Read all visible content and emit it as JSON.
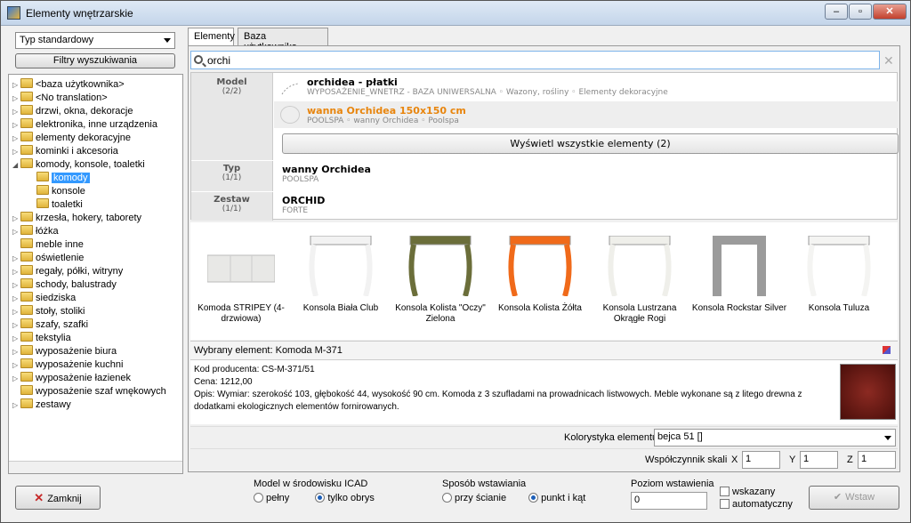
{
  "window": {
    "title": "Elementy wnętrzarskie",
    "min": "–",
    "max": "▫",
    "close": "✕"
  },
  "left": {
    "combo_value": "Typ standardowy",
    "filter_button": "Filtry wyszukiwania",
    "tree": [
      {
        "label": "<baza użytkownika>",
        "level": 0,
        "expander": "▷"
      },
      {
        "label": "<No translation>",
        "level": 0,
        "expander": "▷"
      },
      {
        "label": "drzwi, okna, dekoracje",
        "level": 0,
        "expander": "▷"
      },
      {
        "label": "elektronika, inne urządzenia",
        "level": 0,
        "expander": "▷"
      },
      {
        "label": "elementy dekoracyjne",
        "level": 0,
        "expander": "▷"
      },
      {
        "label": "kominki i akcesoria",
        "level": 0,
        "expander": "▷"
      },
      {
        "label": "komody, konsole, toaletki",
        "level": 0,
        "expander": "◢"
      },
      {
        "label": "komody",
        "level": 1,
        "expander": "",
        "selected": true
      },
      {
        "label": "konsole",
        "level": 1,
        "expander": ""
      },
      {
        "label": "toaletki",
        "level": 1,
        "expander": ""
      },
      {
        "label": "krzesła, hokery, taborety",
        "level": 0,
        "expander": "▷"
      },
      {
        "label": "łóżka",
        "level": 0,
        "expander": "▷"
      },
      {
        "label": "meble inne",
        "level": 0,
        "expander": ""
      },
      {
        "label": "oświetlenie",
        "level": 0,
        "expander": "▷"
      },
      {
        "label": "regały, półki, witryny",
        "level": 0,
        "expander": "▷"
      },
      {
        "label": "schody, balustrady",
        "level": 0,
        "expander": "▷"
      },
      {
        "label": "siedziska",
        "level": 0,
        "expander": "▷"
      },
      {
        "label": "stoły, stoliki",
        "level": 0,
        "expander": "▷"
      },
      {
        "label": "szafy, szafki",
        "level": 0,
        "expander": "▷"
      },
      {
        "label": "tekstylia",
        "level": 0,
        "expander": "▷"
      },
      {
        "label": "wyposażenie biura",
        "level": 0,
        "expander": "▷"
      },
      {
        "label": "wyposażenie kuchni",
        "level": 0,
        "expander": "▷"
      },
      {
        "label": "wyposażenie łazienek",
        "level": 0,
        "expander": "▷"
      },
      {
        "label": "wyposażenie szaf wnękowych",
        "level": 0,
        "expander": ""
      },
      {
        "label": "zestawy",
        "level": 0,
        "expander": "▷"
      }
    ]
  },
  "tabs": [
    {
      "label": "Elementy"
    },
    {
      "label": "Baza użytkownika"
    }
  ],
  "search": {
    "query": "orchi",
    "clear_icon": "✕"
  },
  "results": {
    "model": {
      "label": "Model",
      "count": "(2/2)",
      "items": [
        {
          "name": "orchidea - płatki",
          "path": "WYPOSAŻENIE_WNETRZ - BAZA UNIWERSALNA ◦ Wazony, rośliny ◦ Elementy dekoracyjne"
        },
        {
          "name": "wanna Orchidea 150x150 cm",
          "path": "POOLSPA ◦ wanny Orchidea ◦ Poolspa"
        }
      ],
      "show_all": "Wyświetl wszystkie elementy (2)"
    },
    "typ": {
      "label": "Typ",
      "count": "(1/1)",
      "name": "wanny Orchidea",
      "sub": "POOLSPA"
    },
    "zestaw": {
      "label": "Zestaw",
      "count": "(1/1)",
      "name": "ORCHID",
      "sub": "FORTE"
    }
  },
  "gallery": [
    {
      "label": "Komoda STRIPEY (4-drzwiowa)",
      "color": "#e8e8e6"
    },
    {
      "label": "Konsola Biała Club",
      "color": "#f2f2f2"
    },
    {
      "label": "Konsola Kolista \"Oczy\" Zielona",
      "color": "#6b6e3a"
    },
    {
      "label": "Konsola Kolista Żółta",
      "color": "#f06a1a"
    },
    {
      "label": "Konsola Lustrzana Okrągłe Rogi",
      "color": "#efefea"
    },
    {
      "label": "Konsola Rockstar Silver",
      "color": "#9b9b9b"
    },
    {
      "label": "Konsola Tuluza",
      "color": "#f4f4f2"
    }
  ],
  "selected": {
    "header": "Wybrany element: Komoda M-371",
    "code": "Kod producenta: CS-M-371/51",
    "price": "Cena: 1212,00",
    "desc": "Opis: Wymiar: szerokość 103, głębokość 44, wysokość 90 cm. Komoda z 3 szufladami na prowadnicach listwowych. Meble wykonane są z litego drewna z dodatkami ekologicznych elementów fornirowanych."
  },
  "color": {
    "label": "Kolorystyka elementu",
    "value": "bejca 51 []"
  },
  "scale": {
    "label": "Współczynnik skali",
    "x_label": "X",
    "x": "1",
    "y_label": "Y",
    "y": "1",
    "z_label": "Z",
    "z": "1"
  },
  "bottom": {
    "close": "Zamknij",
    "model_group": {
      "title": "Model w środowisku ICAD",
      "opt1": "pełny",
      "opt2": "tylko obrys"
    },
    "insert_group": {
      "title": "Sposób wstawiania",
      "opt1": "przy ścianie",
      "opt2": "punkt i kąt"
    },
    "level": {
      "title": "Poziom wstawienia",
      "value": "0",
      "chk1": "wskazany",
      "chk2": "automatyczny"
    },
    "insert": "Wstaw"
  }
}
